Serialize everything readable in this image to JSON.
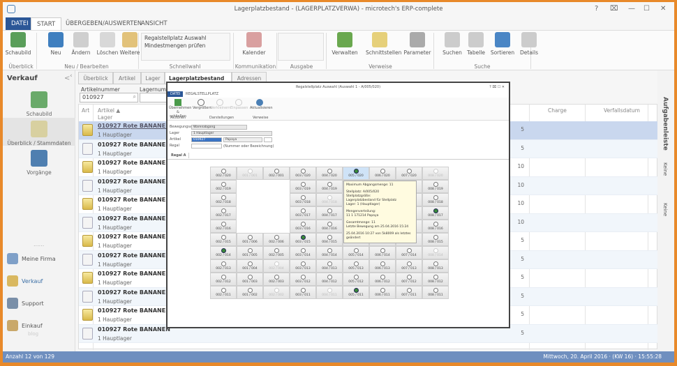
{
  "title": "Lagerplatzbestand - (LAGERPLATZVERWA) - microtech's ERP-complete",
  "window_controls": [
    "?",
    "⌧",
    "—",
    "☐",
    "✕"
  ],
  "ribbon_tabs": [
    "DATEI",
    "START",
    "ÜBERGEBEN/AUSWERTEN",
    "ANSICHT"
  ],
  "ribbon": {
    "buttons": [
      {
        "label": "Schaubild",
        "color": "#5a9e5a"
      },
      {
        "label": "Neu",
        "color": "#3f7fbf"
      },
      {
        "label": "Ändern",
        "color": "#cfcfcf"
      },
      {
        "label": "Löschen",
        "color": "#d8d8d8"
      },
      {
        "label": "Weitere",
        "color": "#e2c27a"
      },
      {
        "label": "Kalender",
        "color": "#d9a0a0"
      },
      {
        "label": "Verwalten",
        "color": "#6aa84f"
      },
      {
        "label": "Schnittstellen",
        "color": "#e6d07a"
      },
      {
        "label": "Parameter",
        "color": "#aaaaaa"
      },
      {
        "label": "Suchen",
        "color": "#cccccc"
      },
      {
        "label": "Tabelle",
        "color": "#cccccc"
      },
      {
        "label": "Sortieren",
        "color": "#4a86c5"
      },
      {
        "label": "Details",
        "color": "#cccccc"
      }
    ],
    "quick": [
      "Regalstellplatz Auswahl",
      "Mindestmengen prüfen"
    ],
    "groups": [
      "Überblick",
      "Neu / Bearbeiten",
      "Schnellwahl",
      "Kommunikation",
      "Ausgabe",
      "Verweise",
      "Suche"
    ]
  },
  "sidebar": {
    "title": "Verkauf",
    "collapse": "<",
    "nav": [
      "Schaubild",
      "Überblick / Stammdaten",
      "Vorgänge"
    ],
    "modules": [
      "Meine Firma",
      "Verkauf",
      "Support",
      "Einkauf"
    ],
    "grip": "......",
    "blog": "blog"
  },
  "tabs": [
    "Überblick",
    "Artikel",
    "Lager",
    "Lagerplatzbestand",
    "Adressen"
  ],
  "tab_close": "✕",
  "filter": {
    "label1": "Artikelnummer",
    "value1": "010927",
    "label2": "Lagernumm"
  },
  "columns": {
    "art": "Art",
    "artikel": "Artikel ▲",
    "lager": "Lager",
    "charge": "Charge",
    "verfall": "Verfallsdatum"
  },
  "rows": [
    {
      "type": "box",
      "name": "010927 Rote BANANEN",
      "lager": "1 Hauptlager",
      "qty": "5"
    },
    {
      "type": "doc",
      "name": "010927 Rote BANANEN",
      "lager": "1 Hauptlager",
      "qty": "5"
    },
    {
      "type": "box",
      "name": "010927 Rote BANANEN",
      "lager": "1 Hauptlager",
      "qty": "10"
    },
    {
      "type": "doc",
      "name": "010927 Rote BANANEN",
      "lager": "1 Hauptlager",
      "qty": "10"
    },
    {
      "type": "box",
      "name": "010927 Rote BANANEN",
      "lager": "1 Hauptlager",
      "qty": "10"
    },
    {
      "type": "doc",
      "name": "010927 Rote BANANEN",
      "lager": "1 Hauptlager",
      "qty": "10"
    },
    {
      "type": "box",
      "name": "010927 Rote BANANEN",
      "lager": "1 Hauptlager",
      "qty": "5"
    },
    {
      "type": "doc",
      "name": "010927 Rote BANANEN",
      "lager": "1 Hauptlager",
      "qty": "5"
    },
    {
      "type": "box",
      "name": "010927 Rote BANANEN",
      "lager": "1 Hauptlager",
      "qty": "5"
    },
    {
      "type": "doc",
      "name": "010927 Rote BANANEN",
      "lager": "1 Hauptlager",
      "qty": "5"
    },
    {
      "type": "box",
      "name": "010927 Rote BANANEN",
      "lager": "1 Hauptlager",
      "qty": "5"
    },
    {
      "type": "doc",
      "name": "010927 Rote BANANEN",
      "lager": "1 Hauptlager",
      "qty": "5"
    }
  ],
  "right_bar": [
    "Aufgabenleiste",
    "Keine",
    "Keine"
  ],
  "status": {
    "left": "Anzahl 12 von 129",
    "right": "Mittwoch, 20. April 2016 · (KW 16) · 15:55:28"
  },
  "dialog": {
    "title": "Regalstellplatz Auswahl (Auswahl 1 - A/005/020)",
    "controls": "?  ⌧  ☐  ✕",
    "tabs": [
      "DATEI",
      "REGALSTELLPLATZ"
    ],
    "buttons": [
      "Übernehmen & schließen",
      "Vergrößern",
      "Verkleinern",
      "Einpassen",
      "Aktualisieren"
    ],
    "groups": [
      "Aktionen",
      "Darstellungen",
      "Verweise"
    ],
    "fields": [
      {
        "label": "Bewegungsart",
        "value": "Warenabgang"
      },
      {
        "label": "Lager",
        "value": "1 Hauptlager"
      },
      {
        "label": "Artikel",
        "value": "010927",
        "extra": "Papaya"
      },
      {
        "label": "Regal",
        "value": "",
        "hint": "(Nummer oder Bezeichnung)"
      }
    ],
    "regal_tab": "Regal A",
    "grid": {
      "rows": [
        [
          "002 / 020",
          "001 / 001",
          "002 / 001",
          "003 / 020",
          "004 / 020",
          "005 / 020",
          "006 / 020",
          "007 / 020",
          "008 / 020"
        ],
        [
          "002 / 019",
          "",
          "",
          "003 / 019",
          "004 / 019",
          "005 / 019",
          "006 / 019",
          "007 / 019",
          "008 / 019"
        ],
        [
          "002 / 018",
          "",
          "",
          "003 / 018",
          "004 / 018",
          "005 / 018",
          "006 / 018",
          "007 / 018",
          "008 / 018"
        ],
        [
          "002 / 017",
          "",
          "",
          "003 / 017",
          "004 / 017",
          "005 / 017",
          "006 / 017",
          "007 / 017",
          "008 / 017"
        ],
        [
          "002 / 016",
          "",
          "",
          "003 / 016",
          "004 / 016",
          "005 / 016",
          "006 / 016",
          "007 / 016",
          "008 / 016"
        ],
        [
          "002 / 015",
          "001 / 006",
          "002 / 006",
          "003 / 015",
          "004 / 015",
          "005 / 015",
          "006 / 015",
          "007 / 015",
          "008 / 015"
        ],
        [
          "002 / 014",
          "001 / 005",
          "002 / 005",
          "003 / 014",
          "004 / 014",
          "005 / 014",
          "006 / 014",
          "007 / 014",
          "008 / 014"
        ],
        [
          "002 / 013",
          "001 / 004",
          "002 / 004",
          "003 / 013",
          "004 / 013",
          "005 / 013",
          "006 / 013",
          "007 / 013",
          "008 / 013"
        ],
        [
          "002 / 012",
          "001 / 003",
          "002 / 003",
          "003 / 012",
          "004 / 012",
          "005 / 012",
          "006 / 012",
          "007 / 012",
          "008 / 012"
        ],
        [
          "002 / 011",
          "001 / 002",
          "002 / 002",
          "003 / 011",
          "004 / 011",
          "005 / 011",
          "006 / 011",
          "007 / 011",
          "008 / 011"
        ]
      ],
      "states": [
        [
          "",
          "d",
          "",
          "",
          "",
          "gh",
          "",
          "",
          "d"
        ],
        [
          "",
          "",
          "",
          "",
          "",
          "",
          "",
          "",
          ""
        ],
        [
          "",
          "",
          "",
          "",
          "d",
          "",
          "",
          "",
          ""
        ],
        [
          "",
          "",
          "",
          "",
          "",
          "",
          "",
          "",
          "g"
        ],
        [
          "",
          "",
          "",
          "",
          "",
          "",
          "",
          "",
          ""
        ],
        [
          "",
          "",
          "",
          "g",
          "",
          "",
          "",
          "",
          ""
        ],
        [
          "g",
          "",
          "",
          "",
          "",
          "",
          "",
          "",
          "d"
        ],
        [
          "",
          "",
          "d",
          "",
          "",
          "",
          "",
          "",
          ""
        ],
        [
          "",
          "",
          "",
          "",
          "",
          "",
          "",
          "",
          ""
        ],
        [
          "",
          "",
          "d",
          "",
          "d",
          "g",
          "",
          "",
          ""
        ]
      ]
    },
    "tooltip": [
      "Maximum Abgangsmenge: 11",
      "Stellplatz: A/005/020",
      "Stellplatzgröße:",
      "Lagerplatzbestand für Stellplatz",
      "Lager: 1 (Hauptlager)",
      "Mengenverteilung:",
      "11 1 171214 Papaya",
      "Gesamtmenge: 11",
      "Letzte Bewegung am 25.04.2016 15:24",
      "25.04.2016 10:27 von 5k8009 als letztes geändert"
    ]
  }
}
